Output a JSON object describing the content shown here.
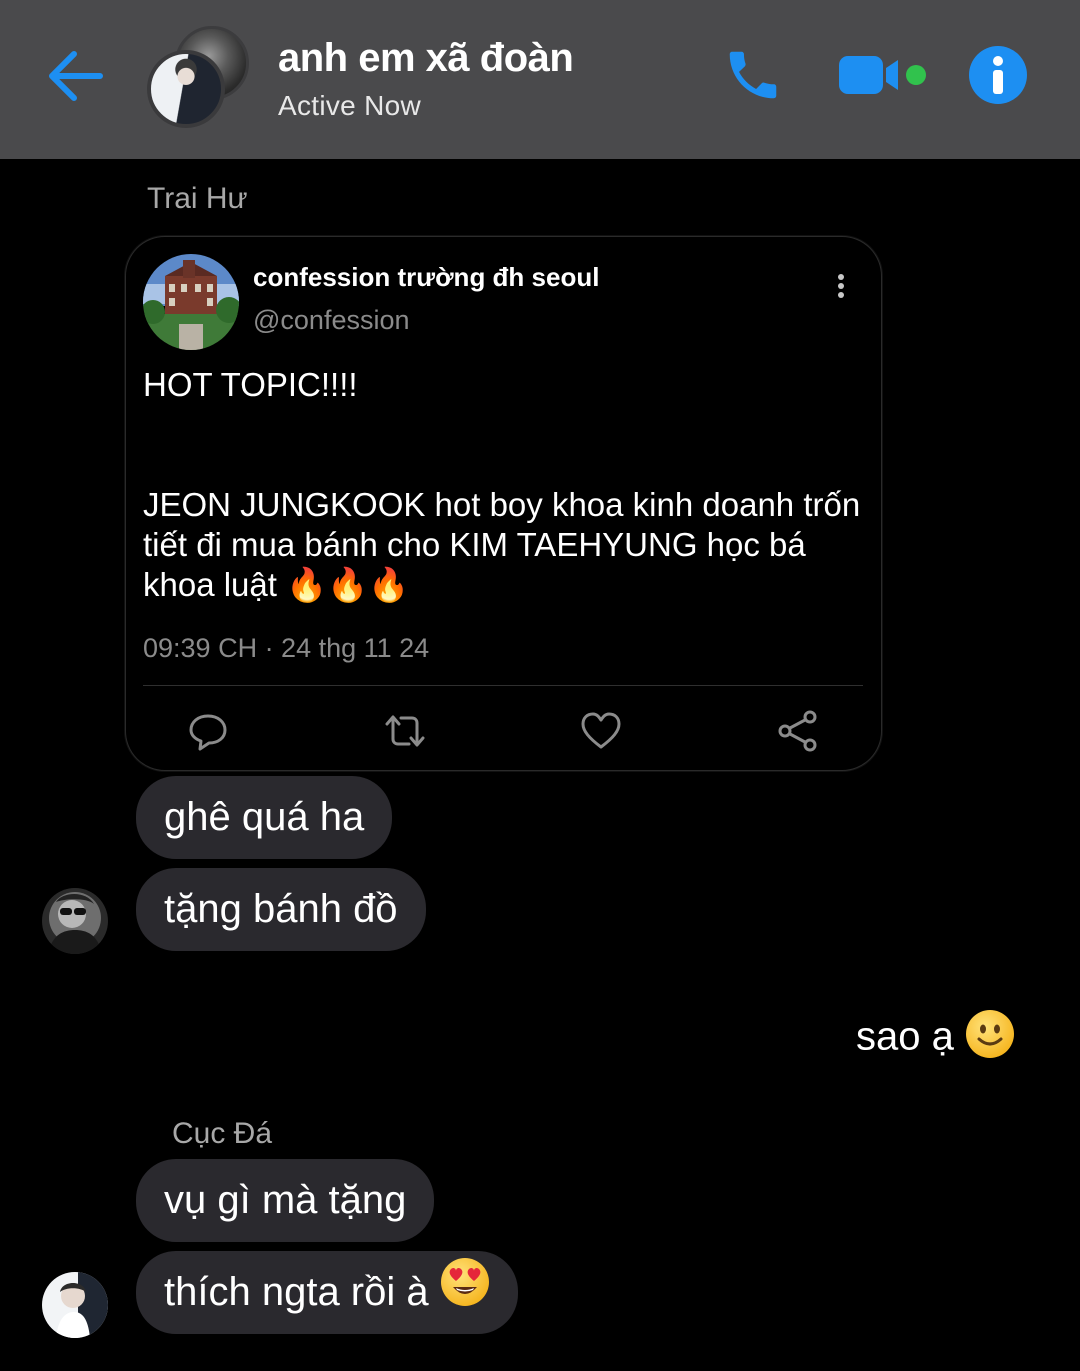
{
  "header": {
    "title": "anh em xã đoàn",
    "status": "Active Now",
    "accent_color": "#1d8ff2",
    "online_color": "#31c24d"
  },
  "messages": {
    "sender_1": "Trai Hư",
    "tweet": {
      "author": "confession trường đh seoul",
      "handle": "@confession",
      "text": "HOT TOPIC!!!!\n\n\nJEON JUNGKOOK hot boy khoa kinh doanh trốn tiết đi mua bánh cho KIM TAEHYUNG học bá khoa luật 🔥🔥🔥",
      "timestamp": "09:39 CH · 24 thg 11 24"
    },
    "bubble_1": "ghê quá ha",
    "bubble_2": "tặng bánh đồ",
    "outgoing_1": "sao ạ",
    "sender_2": "Cục Đá",
    "bubble_3": "vụ gì mà tặng",
    "bubble_4": "thích ngta rồi à"
  },
  "icons": {
    "back": "arrow-left",
    "call": "phone",
    "video": "video-camera",
    "info": "info-circle",
    "more": "vertical-ellipsis",
    "reply": "speech-bubble",
    "retweet": "retweet",
    "like": "heart",
    "share": "share-nodes"
  }
}
